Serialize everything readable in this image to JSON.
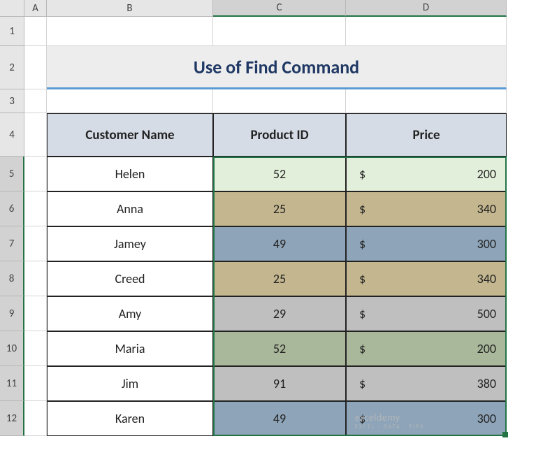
{
  "columns": [
    "A",
    "B",
    "C",
    "D"
  ],
  "rowNumbers": [
    1,
    2,
    3,
    4,
    5,
    6,
    7,
    8,
    9,
    10,
    11,
    12
  ],
  "title": "Use of Find Command",
  "headers": {
    "name": "Customer Name",
    "pid": "Product ID",
    "price": "Price"
  },
  "currency": "$",
  "rows": [
    {
      "name": "Helen",
      "pid": 52,
      "price": 200,
      "fill": "lightgreen"
    },
    {
      "name": "Anna",
      "pid": 25,
      "price": 340,
      "fill": "tan"
    },
    {
      "name": "Jamey",
      "pid": 49,
      "price": 300,
      "fill": "slate"
    },
    {
      "name": "Creed",
      "pid": 25,
      "price": 340,
      "fill": "tan"
    },
    {
      "name": "Amy",
      "pid": 29,
      "price": 500,
      "fill": "gray"
    },
    {
      "name": "Maria",
      "pid": 52,
      "price": 200,
      "fill": "sage"
    },
    {
      "name": "Jim",
      "pid": 91,
      "price": 380,
      "fill": "gray"
    },
    {
      "name": "Karen",
      "pid": 49,
      "price": 300,
      "fill": "slate"
    }
  ],
  "watermark": {
    "brand": "exceldemy",
    "tag": "EXCEL · DATA · TIPS"
  },
  "chart_data": {
    "type": "table",
    "title": "Use of Find Command",
    "columns": [
      "Customer Name",
      "Product ID",
      "Price"
    ],
    "rows": [
      [
        "Helen",
        52,
        200
      ],
      [
        "Anna",
        25,
        340
      ],
      [
        "Jamey",
        49,
        300
      ],
      [
        "Creed",
        25,
        340
      ],
      [
        "Amy",
        29,
        500
      ],
      [
        "Maria",
        52,
        200
      ],
      [
        "Jim",
        91,
        380
      ],
      [
        "Karen",
        49,
        300
      ]
    ]
  }
}
